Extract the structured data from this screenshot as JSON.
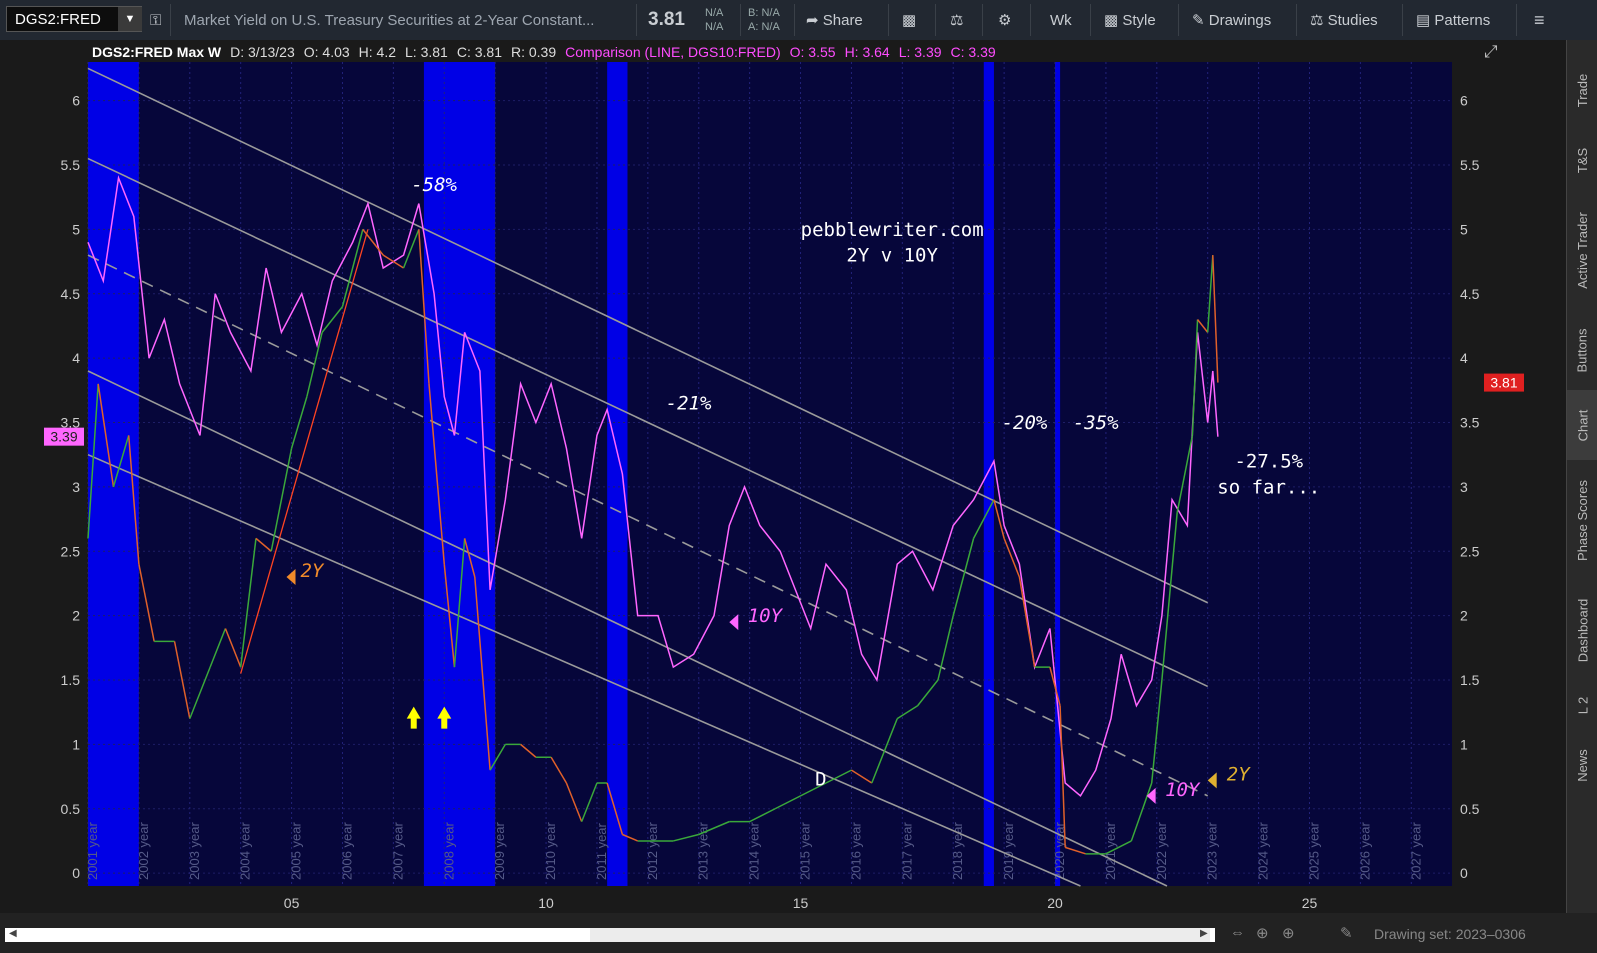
{
  "toolbar": {
    "symbol": "DGS2:FRED",
    "description": "Market Yield on U.S. Treasury Securities at 2-Year Constant...",
    "last_price": "3.81",
    "na1": "N/A",
    "na2": "N/A",
    "bid": "B: N/A",
    "ask": "A: N/A",
    "share": "Share",
    "aggregation": "Wk",
    "style": "Style",
    "drawings": "Drawings",
    "studies": "Studies",
    "patterns": "Patterns"
  },
  "infobar": {
    "title": "DGS2:FRED Max W",
    "date": "D: 3/13/23",
    "open": "O: 4.03",
    "high": "H: 4.2",
    "low": "L: 3.81",
    "close": "C: 3.81",
    "range": "R: 0.39",
    "comparison": "Comparison (LINE, DGS10:FRED)",
    "c_open": "O: 3.55",
    "c_high": "H: 3.64",
    "c_low": "L: 3.39",
    "c_close": "C: 3.39"
  },
  "right_tabs": [
    "Trade",
    "T&S",
    "Active Trader",
    "Buttons",
    "Chart",
    "Phase Scores",
    "Dashboard",
    "L 2",
    "News"
  ],
  "drawing_set": "Drawing set: 2023–0306",
  "colors": {
    "plot_bg": "#06063a",
    "recession": "#0000e6",
    "dgs10": "#ff66ff",
    "dgs2_up": "#3aa83a",
    "dgs2_down": "#e0602a",
    "channel": "#9a9a9a",
    "label_orange": "#f08a2a",
    "label_gold": "#e0b030"
  },
  "chart_data": {
    "type": "line",
    "x_range": [
      2001.0,
      2027.8
    ],
    "ylim": [
      -0.1,
      6.3
    ],
    "y_ticks": [
      "6",
      "5.5",
      "5",
      "4.5",
      "4",
      "3.5",
      "3",
      "2.5",
      "2",
      "1.5",
      "1",
      "0.5",
      "0"
    ],
    "x_tick_labels": [
      "05",
      "10",
      "15",
      "20",
      "25"
    ],
    "year_labels": [
      "2001 year",
      "2002 year",
      "2003 year",
      "2004 year",
      "2005 year",
      "2006 year",
      "2007 year",
      "2008 year",
      "2009 year",
      "2010 year",
      "2011 year",
      "2012 year",
      "2013 year",
      "2014 year",
      "2015 year",
      "2016 year",
      "2017 year",
      "2018 year",
      "2019 year",
      "2020 year",
      "2021 year",
      "2022 year",
      "2023 year",
      "2024 year",
      "2025 year",
      "2026 year",
      "2027 year"
    ],
    "recession_bands": [
      [
        2001.0,
        2002.0
      ],
      [
        2007.6,
        2009.0
      ],
      [
        2011.2,
        2011.6
      ],
      [
        2018.6,
        2018.8
      ],
      [
        2020.0,
        2020.1
      ]
    ],
    "series": [
      {
        "name": "DGS10",
        "points": [
          [
            2001.0,
            4.9
          ],
          [
            2001.3,
            4.6
          ],
          [
            2001.6,
            5.4
          ],
          [
            2001.9,
            5.1
          ],
          [
            2002.2,
            4.0
          ],
          [
            2002.5,
            4.3
          ],
          [
            2002.8,
            3.8
          ],
          [
            2003.2,
            3.4
          ],
          [
            2003.5,
            4.5
          ],
          [
            2003.8,
            4.2
          ],
          [
            2004.2,
            3.9
          ],
          [
            2004.5,
            4.7
          ],
          [
            2004.8,
            4.2
          ],
          [
            2005.2,
            4.5
          ],
          [
            2005.5,
            4.1
          ],
          [
            2005.8,
            4.6
          ],
          [
            2006.2,
            4.9
          ],
          [
            2006.5,
            5.2
          ],
          [
            2006.8,
            4.7
          ],
          [
            2007.2,
            4.8
          ],
          [
            2007.5,
            5.2
          ],
          [
            2007.8,
            4.5
          ],
          [
            2008.0,
            3.7
          ],
          [
            2008.2,
            3.4
          ],
          [
            2008.4,
            4.2
          ],
          [
            2008.7,
            3.9
          ],
          [
            2008.9,
            2.2
          ],
          [
            2009.2,
            2.9
          ],
          [
            2009.5,
            3.8
          ],
          [
            2009.8,
            3.5
          ],
          [
            2010.1,
            3.8
          ],
          [
            2010.4,
            3.3
          ],
          [
            2010.7,
            2.6
          ],
          [
            2011.0,
            3.4
          ],
          [
            2011.2,
            3.6
          ],
          [
            2011.5,
            3.1
          ],
          [
            2011.8,
            2.0
          ],
          [
            2012.2,
            2.0
          ],
          [
            2012.5,
            1.6
          ],
          [
            2012.9,
            1.7
          ],
          [
            2013.3,
            2.0
          ],
          [
            2013.6,
            2.7
          ],
          [
            2013.9,
            3.0
          ],
          [
            2014.2,
            2.7
          ],
          [
            2014.6,
            2.5
          ],
          [
            2014.9,
            2.2
          ],
          [
            2015.2,
            1.9
          ],
          [
            2015.5,
            2.4
          ],
          [
            2015.9,
            2.2
          ],
          [
            2016.2,
            1.7
          ],
          [
            2016.5,
            1.5
          ],
          [
            2016.9,
            2.4
          ],
          [
            2017.2,
            2.5
          ],
          [
            2017.6,
            2.2
          ],
          [
            2018.0,
            2.7
          ],
          [
            2018.4,
            2.9
          ],
          [
            2018.8,
            3.2
          ],
          [
            2019.0,
            2.7
          ],
          [
            2019.3,
            2.4
          ],
          [
            2019.6,
            1.6
          ],
          [
            2019.9,
            1.9
          ],
          [
            2020.2,
            0.7
          ],
          [
            2020.5,
            0.6
          ],
          [
            2020.8,
            0.8
          ],
          [
            2021.1,
            1.2
          ],
          [
            2021.3,
            1.7
          ],
          [
            2021.6,
            1.3
          ],
          [
            2021.9,
            1.5
          ],
          [
            2022.1,
            2.0
          ],
          [
            2022.3,
            2.9
          ],
          [
            2022.6,
            2.7
          ],
          [
            2022.8,
            4.2
          ],
          [
            2023.0,
            3.5
          ],
          [
            2023.1,
            3.9
          ],
          [
            2023.2,
            3.39
          ]
        ]
      },
      {
        "name": "DGS2",
        "points": [
          [
            2001.0,
            2.6
          ],
          [
            2001.2,
            3.8
          ],
          [
            2001.5,
            3.0
          ],
          [
            2001.8,
            3.4
          ],
          [
            2002.0,
            2.4
          ],
          [
            2002.3,
            1.8
          ],
          [
            2002.7,
            1.8
          ],
          [
            2003.0,
            1.2
          ],
          [
            2003.4,
            1.6
          ],
          [
            2003.7,
            1.9
          ],
          [
            2004.0,
            1.6
          ],
          [
            2004.3,
            2.6
          ],
          [
            2004.6,
            2.5
          ],
          [
            2005.0,
            3.3
          ],
          [
            2005.3,
            3.7
          ],
          [
            2005.6,
            4.2
          ],
          [
            2006.0,
            4.4
          ],
          [
            2006.4,
            5.0
          ],
          [
            2006.8,
            4.8
          ],
          [
            2007.2,
            4.7
          ],
          [
            2007.5,
            5.0
          ],
          [
            2007.7,
            3.8
          ],
          [
            2008.0,
            2.4
          ],
          [
            2008.2,
            1.6
          ],
          [
            2008.4,
            2.6
          ],
          [
            2008.6,
            2.3
          ],
          [
            2008.9,
            0.8
          ],
          [
            2009.2,
            1.0
          ],
          [
            2009.5,
            1.0
          ],
          [
            2009.8,
            0.9
          ],
          [
            2010.1,
            0.9
          ],
          [
            2010.4,
            0.7
          ],
          [
            2010.7,
            0.4
          ],
          [
            2011.0,
            0.7
          ],
          [
            2011.2,
            0.7
          ],
          [
            2011.5,
            0.3
          ],
          [
            2011.8,
            0.25
          ],
          [
            2012.5,
            0.25
          ],
          [
            2013.0,
            0.3
          ],
          [
            2013.6,
            0.4
          ],
          [
            2014.0,
            0.4
          ],
          [
            2014.5,
            0.5
          ],
          [
            2015.0,
            0.6
          ],
          [
            2015.5,
            0.7
          ],
          [
            2016.0,
            0.8
          ],
          [
            2016.4,
            0.7
          ],
          [
            2016.9,
            1.2
          ],
          [
            2017.3,
            1.3
          ],
          [
            2017.7,
            1.5
          ],
          [
            2018.0,
            2.0
          ],
          [
            2018.4,
            2.6
          ],
          [
            2018.8,
            2.9
          ],
          [
            2019.0,
            2.6
          ],
          [
            2019.3,
            2.3
          ],
          [
            2019.6,
            1.6
          ],
          [
            2019.9,
            1.6
          ],
          [
            2020.1,
            1.3
          ],
          [
            2020.2,
            0.2
          ],
          [
            2020.6,
            0.15
          ],
          [
            2021.0,
            0.15
          ],
          [
            2021.5,
            0.25
          ],
          [
            2021.9,
            0.7
          ],
          [
            2022.1,
            1.5
          ],
          [
            2022.4,
            2.8
          ],
          [
            2022.7,
            3.4
          ],
          [
            2022.8,
            4.3
          ],
          [
            2023.0,
            4.2
          ],
          [
            2023.1,
            4.8
          ],
          [
            2023.2,
            3.81
          ]
        ]
      }
    ],
    "channel_lines": [
      {
        "from": [
          2001.0,
          6.25
        ],
        "to": [
          2023.0,
          2.1
        ],
        "dashed": false
      },
      {
        "from": [
          2001.0,
          5.55
        ],
        "to": [
          2023.0,
          1.45
        ],
        "dashed": false
      },
      {
        "from": [
          2001.0,
          4.8
        ],
        "to": [
          2023.0,
          0.6
        ],
        "dashed": true
      },
      {
        "from": [
          2001.0,
          3.9
        ],
        "to": [
          2022.2,
          -0.1
        ],
        "dashed": false
      },
      {
        "from": [
          2001.0,
          3.25
        ],
        "to": [
          2020.5,
          -0.1
        ],
        "dashed": false
      }
    ],
    "trend_segment": {
      "from": [
        2004.0,
        1.55
      ],
      "to": [
        2006.5,
        5.0
      ]
    },
    "annotations": [
      {
        "text": "-58%",
        "x": 2007.8,
        "y": 5.3,
        "color": "#ffffff"
      },
      {
        "text": "pebblewriter.com",
        "x": 2016.8,
        "y": 4.95,
        "color": "#ffffff"
      },
      {
        "text": "2Y v 10Y",
        "x": 2016.8,
        "y": 4.75,
        "color": "#ffffff"
      },
      {
        "text": "-21%",
        "x": 2012.8,
        "y": 3.6,
        "color": "#ffffff"
      },
      {
        "text": "-20%",
        "x": 2019.4,
        "y": 3.45,
        "color": "#ffffff"
      },
      {
        "text": "-35%",
        "x": 2020.8,
        "y": 3.45,
        "color": "#ffffff"
      },
      {
        "text": "-27.5%",
        "x": 2024.2,
        "y": 3.15,
        "color": "#ffffff"
      },
      {
        "text": "so far...",
        "x": 2024.2,
        "y": 2.95,
        "color": "#ffffff"
      },
      {
        "text": "2Y",
        "x": 2005.4,
        "y": 2.3,
        "color": "#f08a2a"
      },
      {
        "text": "10Y",
        "x": 2014.3,
        "y": 1.95,
        "color": "#ff66ff"
      },
      {
        "text": "10Y",
        "x": 2022.5,
        "y": 0.6,
        "color": "#ff66ff"
      },
      {
        "text": "2Y",
        "x": 2023.6,
        "y": 0.72,
        "color": "#e0b030"
      },
      {
        "text": "D",
        "x": 2015.4,
        "y": 0.68,
        "color": "#ffffff"
      }
    ],
    "markers": [
      {
        "kind": "tri-left",
        "x": 2004.9,
        "y": 2.3,
        "color": "#f08a2a"
      },
      {
        "kind": "tri-left",
        "x": 2013.6,
        "y": 1.95,
        "color": "#ff66ff"
      },
      {
        "kind": "tri-left",
        "x": 2021.8,
        "y": 0.6,
        "color": "#ff66ff"
      },
      {
        "kind": "tri-left",
        "x": 2023.0,
        "y": 0.72,
        "color": "#e0b030"
      },
      {
        "kind": "arrow-up",
        "x": 2007.4,
        "y": 1.2,
        "color": "#ffff00"
      },
      {
        "kind": "arrow-up",
        "x": 2008.0,
        "y": 1.2,
        "color": "#ffff00"
      }
    ],
    "price_labels": {
      "left": {
        "value": "3.39",
        "y": 3.39,
        "color": "#ff66ff"
      },
      "right": {
        "value": "3.81",
        "y": 3.81,
        "color": "#e02020"
      }
    }
  }
}
